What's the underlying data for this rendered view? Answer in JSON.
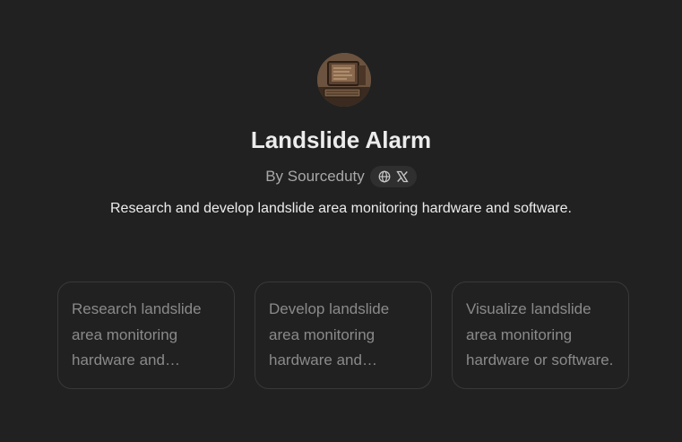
{
  "gpt": {
    "title": "Landslide Alarm",
    "author": "By Sourceduty",
    "description": "Research and develop landslide area monitoring hardware and software.",
    "avatar_icon": "vintage-computer-image",
    "social_icons": [
      "globe-icon",
      "x-logo-icon"
    ]
  },
  "starters": [
    {
      "text": "Research landslide area monitoring hardware and software."
    },
    {
      "text": "Develop landslide area monitoring hardware and software."
    },
    {
      "text": "Visualize landslide area monitoring hardware or software."
    }
  ],
  "colors": {
    "background": "#212121",
    "title": "#ececec",
    "muted": "#a8a8a8",
    "card_border": "#393939",
    "card_text": "#8a8a8a",
    "pill": "#2f2f2f"
  }
}
